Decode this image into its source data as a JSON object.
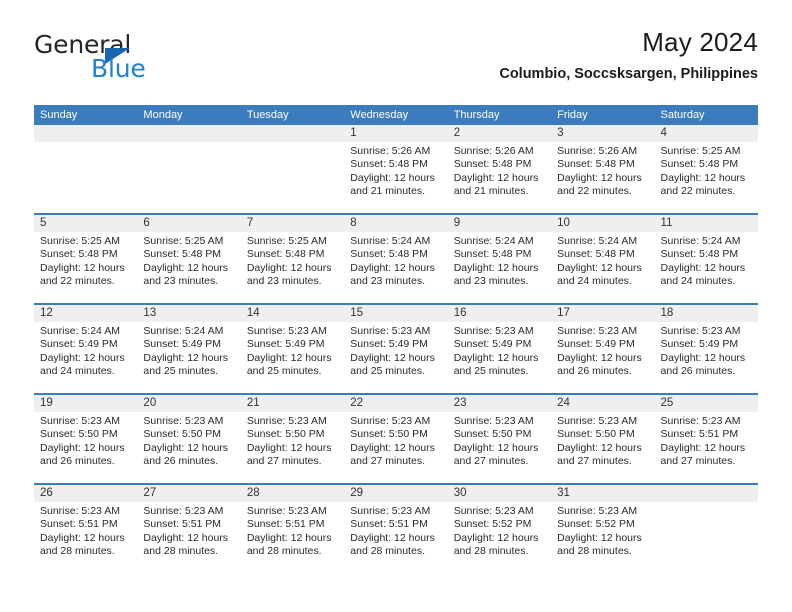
{
  "brand": {
    "name_top": "General",
    "name_bottom": "Blue",
    "triangle_color": "#1565b0",
    "blue_color": "#1f7fd4"
  },
  "header": {
    "title": "May 2024",
    "subtitle": "Columbio, Soccsksargen, Philippines"
  },
  "theme": {
    "header_blue": "#3a7cbe",
    "day_band_gray": "#efefef",
    "text_color": "#2a2a2a"
  },
  "calendar": {
    "weekdays": [
      "Sunday",
      "Monday",
      "Tuesday",
      "Wednesday",
      "Thursday",
      "Friday",
      "Saturday"
    ],
    "weeks": [
      [
        {
          "day": "",
          "empty": true
        },
        {
          "day": "",
          "empty": true
        },
        {
          "day": "",
          "empty": true
        },
        {
          "day": "1",
          "sunrise": "Sunrise: 5:26 AM",
          "sunset": "Sunset: 5:48 PM",
          "daylight_line1": "Daylight: 12 hours",
          "daylight_line2": "and 21 minutes."
        },
        {
          "day": "2",
          "sunrise": "Sunrise: 5:26 AM",
          "sunset": "Sunset: 5:48 PM",
          "daylight_line1": "Daylight: 12 hours",
          "daylight_line2": "and 21 minutes."
        },
        {
          "day": "3",
          "sunrise": "Sunrise: 5:26 AM",
          "sunset": "Sunset: 5:48 PM",
          "daylight_line1": "Daylight: 12 hours",
          "daylight_line2": "and 22 minutes."
        },
        {
          "day": "4",
          "sunrise": "Sunrise: 5:25 AM",
          "sunset": "Sunset: 5:48 PM",
          "daylight_line1": "Daylight: 12 hours",
          "daylight_line2": "and 22 minutes."
        }
      ],
      [
        {
          "day": "5",
          "sunrise": "Sunrise: 5:25 AM",
          "sunset": "Sunset: 5:48 PM",
          "daylight_line1": "Daylight: 12 hours",
          "daylight_line2": "and 22 minutes."
        },
        {
          "day": "6",
          "sunrise": "Sunrise: 5:25 AM",
          "sunset": "Sunset: 5:48 PM",
          "daylight_line1": "Daylight: 12 hours",
          "daylight_line2": "and 23 minutes."
        },
        {
          "day": "7",
          "sunrise": "Sunrise: 5:25 AM",
          "sunset": "Sunset: 5:48 PM",
          "daylight_line1": "Daylight: 12 hours",
          "daylight_line2": "and 23 minutes."
        },
        {
          "day": "8",
          "sunrise": "Sunrise: 5:24 AM",
          "sunset": "Sunset: 5:48 PM",
          "daylight_line1": "Daylight: 12 hours",
          "daylight_line2": "and 23 minutes."
        },
        {
          "day": "9",
          "sunrise": "Sunrise: 5:24 AM",
          "sunset": "Sunset: 5:48 PM",
          "daylight_line1": "Daylight: 12 hours",
          "daylight_line2": "and 23 minutes."
        },
        {
          "day": "10",
          "sunrise": "Sunrise: 5:24 AM",
          "sunset": "Sunset: 5:48 PM",
          "daylight_line1": "Daylight: 12 hours",
          "daylight_line2": "and 24 minutes."
        },
        {
          "day": "11",
          "sunrise": "Sunrise: 5:24 AM",
          "sunset": "Sunset: 5:48 PM",
          "daylight_line1": "Daylight: 12 hours",
          "daylight_line2": "and 24 minutes."
        }
      ],
      [
        {
          "day": "12",
          "sunrise": "Sunrise: 5:24 AM",
          "sunset": "Sunset: 5:49 PM",
          "daylight_line1": "Daylight: 12 hours",
          "daylight_line2": "and 24 minutes."
        },
        {
          "day": "13",
          "sunrise": "Sunrise: 5:24 AM",
          "sunset": "Sunset: 5:49 PM",
          "daylight_line1": "Daylight: 12 hours",
          "daylight_line2": "and 25 minutes."
        },
        {
          "day": "14",
          "sunrise": "Sunrise: 5:23 AM",
          "sunset": "Sunset: 5:49 PM",
          "daylight_line1": "Daylight: 12 hours",
          "daylight_line2": "and 25 minutes."
        },
        {
          "day": "15",
          "sunrise": "Sunrise: 5:23 AM",
          "sunset": "Sunset: 5:49 PM",
          "daylight_line1": "Daylight: 12 hours",
          "daylight_line2": "and 25 minutes."
        },
        {
          "day": "16",
          "sunrise": "Sunrise: 5:23 AM",
          "sunset": "Sunset: 5:49 PM",
          "daylight_line1": "Daylight: 12 hours",
          "daylight_line2": "and 25 minutes."
        },
        {
          "day": "17",
          "sunrise": "Sunrise: 5:23 AM",
          "sunset": "Sunset: 5:49 PM",
          "daylight_line1": "Daylight: 12 hours",
          "daylight_line2": "and 26 minutes."
        },
        {
          "day": "18",
          "sunrise": "Sunrise: 5:23 AM",
          "sunset": "Sunset: 5:49 PM",
          "daylight_line1": "Daylight: 12 hours",
          "daylight_line2": "and 26 minutes."
        }
      ],
      [
        {
          "day": "19",
          "sunrise": "Sunrise: 5:23 AM",
          "sunset": "Sunset: 5:50 PM",
          "daylight_line1": "Daylight: 12 hours",
          "daylight_line2": "and 26 minutes."
        },
        {
          "day": "20",
          "sunrise": "Sunrise: 5:23 AM",
          "sunset": "Sunset: 5:50 PM",
          "daylight_line1": "Daylight: 12 hours",
          "daylight_line2": "and 26 minutes."
        },
        {
          "day": "21",
          "sunrise": "Sunrise: 5:23 AM",
          "sunset": "Sunset: 5:50 PM",
          "daylight_line1": "Daylight: 12 hours",
          "daylight_line2": "and 27 minutes."
        },
        {
          "day": "22",
          "sunrise": "Sunrise: 5:23 AM",
          "sunset": "Sunset: 5:50 PM",
          "daylight_line1": "Daylight: 12 hours",
          "daylight_line2": "and 27 minutes."
        },
        {
          "day": "23",
          "sunrise": "Sunrise: 5:23 AM",
          "sunset": "Sunset: 5:50 PM",
          "daylight_line1": "Daylight: 12 hours",
          "daylight_line2": "and 27 minutes."
        },
        {
          "day": "24",
          "sunrise": "Sunrise: 5:23 AM",
          "sunset": "Sunset: 5:50 PM",
          "daylight_line1": "Daylight: 12 hours",
          "daylight_line2": "and 27 minutes."
        },
        {
          "day": "25",
          "sunrise": "Sunrise: 5:23 AM",
          "sunset": "Sunset: 5:51 PM",
          "daylight_line1": "Daylight: 12 hours",
          "daylight_line2": "and 27 minutes."
        }
      ],
      [
        {
          "day": "26",
          "sunrise": "Sunrise: 5:23 AM",
          "sunset": "Sunset: 5:51 PM",
          "daylight_line1": "Daylight: 12 hours",
          "daylight_line2": "and 28 minutes."
        },
        {
          "day": "27",
          "sunrise": "Sunrise: 5:23 AM",
          "sunset": "Sunset: 5:51 PM",
          "daylight_line1": "Daylight: 12 hours",
          "daylight_line2": "and 28 minutes."
        },
        {
          "day": "28",
          "sunrise": "Sunrise: 5:23 AM",
          "sunset": "Sunset: 5:51 PM",
          "daylight_line1": "Daylight: 12 hours",
          "daylight_line2": "and 28 minutes."
        },
        {
          "day": "29",
          "sunrise": "Sunrise: 5:23 AM",
          "sunset": "Sunset: 5:51 PM",
          "daylight_line1": "Daylight: 12 hours",
          "daylight_line2": "and 28 minutes."
        },
        {
          "day": "30",
          "sunrise": "Sunrise: 5:23 AM",
          "sunset": "Sunset: 5:52 PM",
          "daylight_line1": "Daylight: 12 hours",
          "daylight_line2": "and 28 minutes."
        },
        {
          "day": "31",
          "sunrise": "Sunrise: 5:23 AM",
          "sunset": "Sunset: 5:52 PM",
          "daylight_line1": "Daylight: 12 hours",
          "daylight_line2": "and 28 minutes."
        },
        {
          "day": "",
          "empty": true
        }
      ]
    ]
  }
}
